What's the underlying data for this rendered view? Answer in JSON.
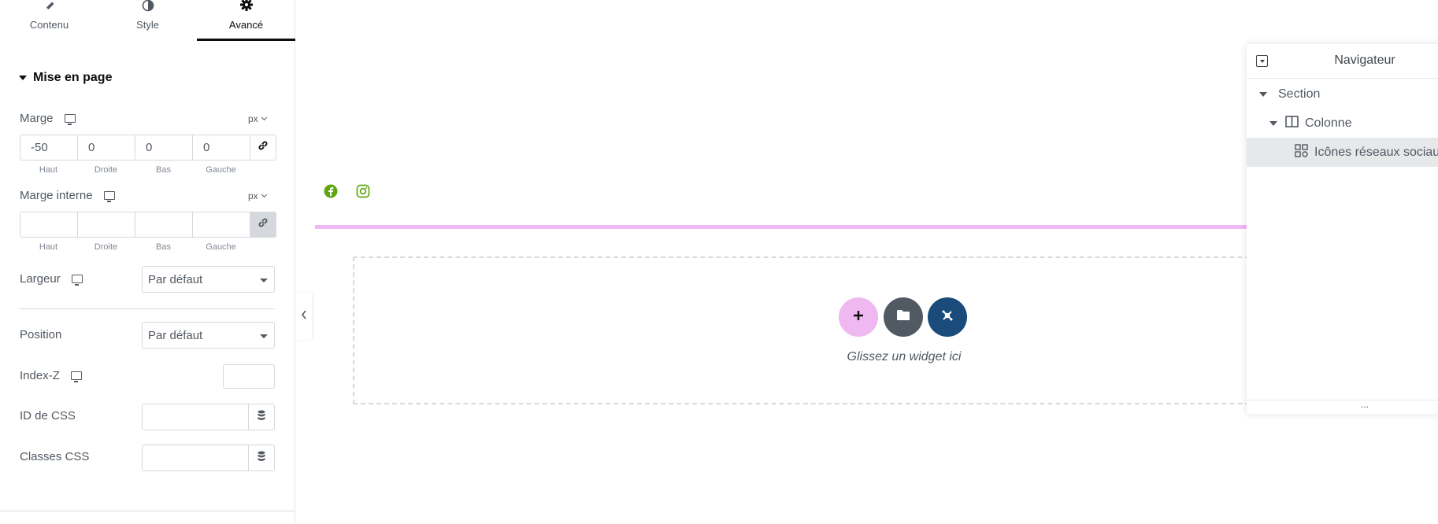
{
  "tabs": [
    {
      "label": "Contenu",
      "icon": "pencil-icon"
    },
    {
      "label": "Style",
      "icon": "contrast-icon"
    },
    {
      "label": "Avancé",
      "icon": "gear-icon",
      "active": true
    }
  ],
  "section": {
    "title": "Mise en page"
  },
  "margin": {
    "label": "Marge",
    "unit": "px",
    "values": [
      "-50",
      "0",
      "0",
      "0"
    ],
    "sublabels": [
      "Haut",
      "Droite",
      "Bas",
      "Gauche"
    ]
  },
  "padding": {
    "label": "Marge interne",
    "unit": "px",
    "values": [
      "",
      "",
      "",
      ""
    ],
    "sublabels": [
      "Haut",
      "Droite",
      "Bas",
      "Gauche"
    ]
  },
  "width": {
    "label": "Largeur",
    "value": "Par défaut"
  },
  "position": {
    "label": "Position",
    "value": "Par défaut"
  },
  "zindex": {
    "label": "Index-Z",
    "value": ""
  },
  "css_id": {
    "label": "ID de CSS",
    "value": ""
  },
  "css_classes": {
    "label": "Classes CSS",
    "value": ""
  },
  "canvas": {
    "drop_text": "Glissez un widget ici",
    "accent_pink": "#f0b8f0",
    "facebook_color": "#61a512",
    "instagram_color": "#61a512",
    "folder_button_color": "#515962",
    "kit_button_color": "#1a4b7a"
  },
  "navigator": {
    "title": "Navigateur",
    "items": [
      {
        "label": "Section",
        "icon": "caret-down-icon"
      },
      {
        "label": "Colonne",
        "icon": "column-icon"
      },
      {
        "label": "Icônes réseaux sociaux",
        "icon": "social-icons-icon"
      }
    ],
    "footer": "..."
  }
}
